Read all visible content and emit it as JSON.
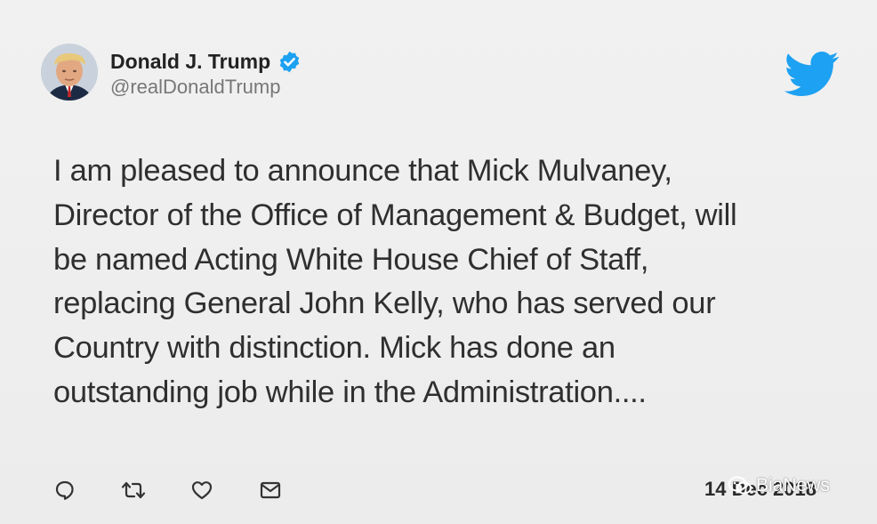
{
  "author": {
    "display_name": "Donald J. Trump",
    "handle": "@realDonaldTrump",
    "verified": true
  },
  "tweet": {
    "lines": [
      "I am pleased to announce that Mick Mulvaney,",
      "Director of the Office of Management & Budget, will",
      "be named Acting White House Chief of Staff,",
      "replacing General John Kelly, who has served our",
      "Country with distinction. Mick has done an",
      "outstanding job while in the Administration...."
    ],
    "timestamp": "14 Dec 2018"
  },
  "actions": [
    {
      "name": "reply-icon"
    },
    {
      "name": "retweet-icon"
    },
    {
      "name": "like-icon"
    },
    {
      "name": "message-icon"
    }
  ],
  "icons": {
    "brand": "twitter-bird-icon",
    "verified": "verified-badge-icon"
  },
  "watermark": {
    "text": "BiaNews"
  },
  "colors": {
    "twitter_blue": "#1da1f2",
    "background": "#efefef",
    "text": "#2f2f2f",
    "handle": "#777777"
  }
}
